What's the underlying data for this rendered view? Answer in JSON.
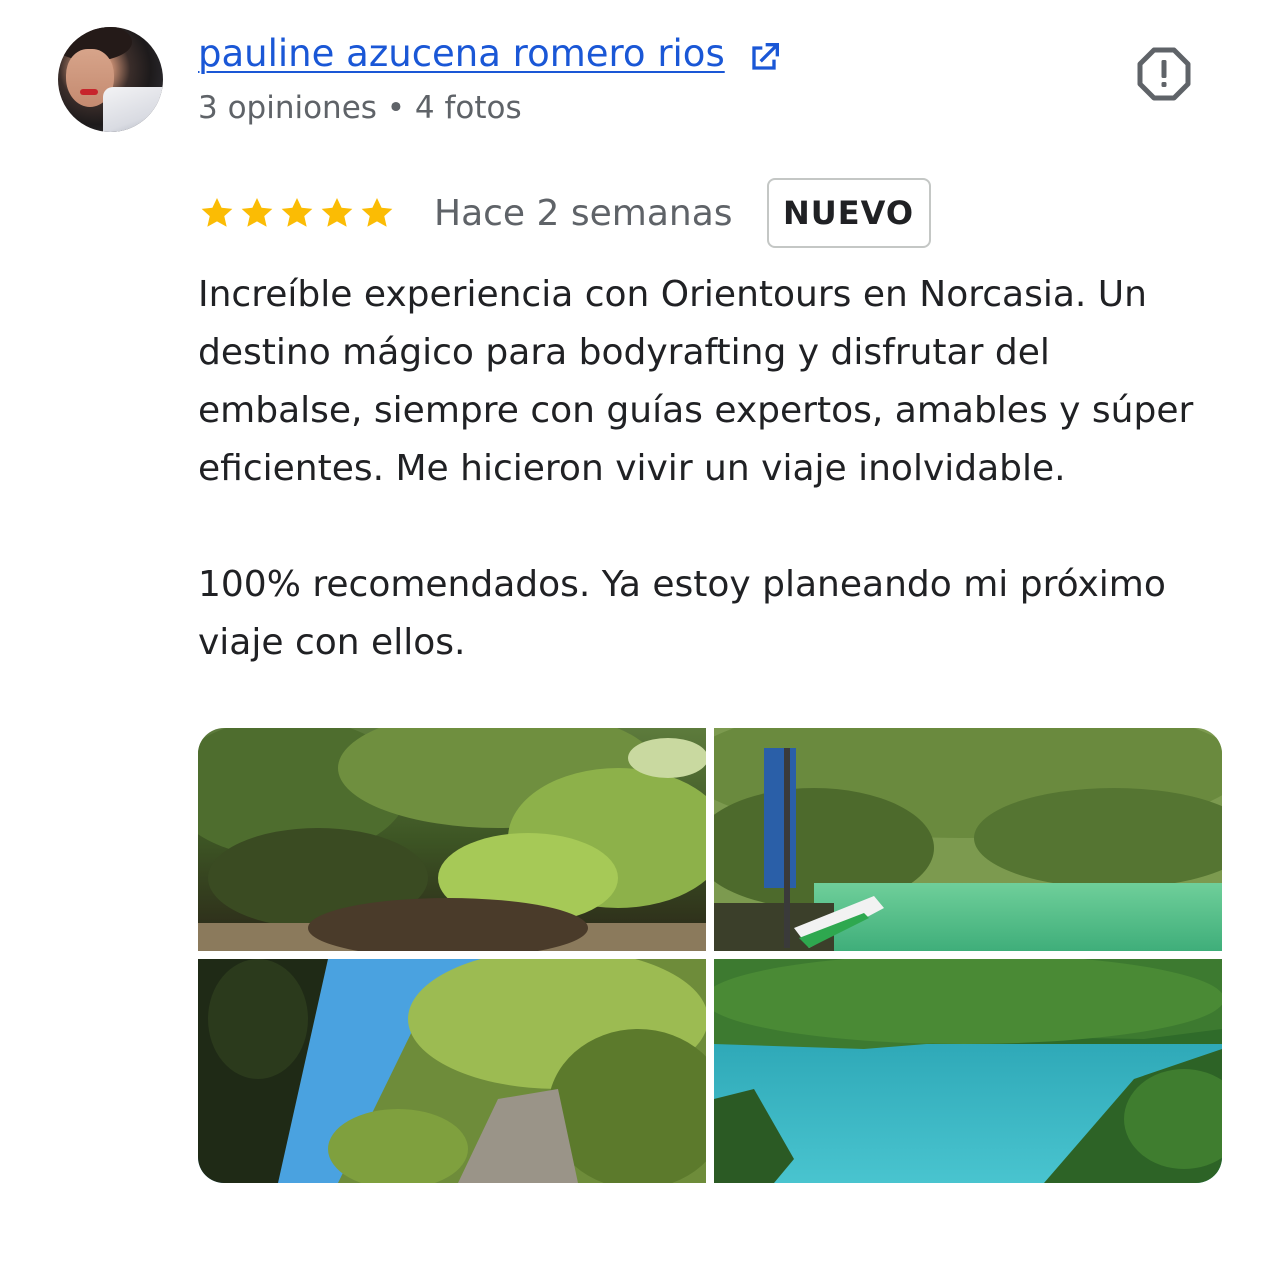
{
  "author": {
    "name": "pauline azucena romero rios",
    "meta": "3 opiniones • 4 fotos",
    "avatar_icon": "user-avatar"
  },
  "review": {
    "rating": 5,
    "rating_max": 5,
    "time": "Hace 2 semanas",
    "badge": "NUEVO",
    "paragraphs": [
      "Increíble experiencia con Orientours en Norcasia. Un destino mágico para bodyrafting y disfrutar del embalse, siempre con guías expertos, amables y súper eficientes. Me hicieron vivir un viaje inolvidable.",
      "100% recomendados. Ya estoy planeando mi próximo viaje con ellos."
    ]
  },
  "icons": {
    "external_link": "open-in-new-icon",
    "report": "report-icon",
    "star": "star-icon"
  },
  "colors": {
    "link": "#1a57d6",
    "star": "#fbbc04",
    "text": "#202124",
    "muted": "#5f6368",
    "badge_border": "#c4c7c5"
  },
  "photos": [
    {
      "subject": "forest-canopy"
    },
    {
      "subject": "lake-with-boat"
    },
    {
      "subject": "cliff-and-sky"
    },
    {
      "subject": "turquoise-reservoir"
    }
  ]
}
